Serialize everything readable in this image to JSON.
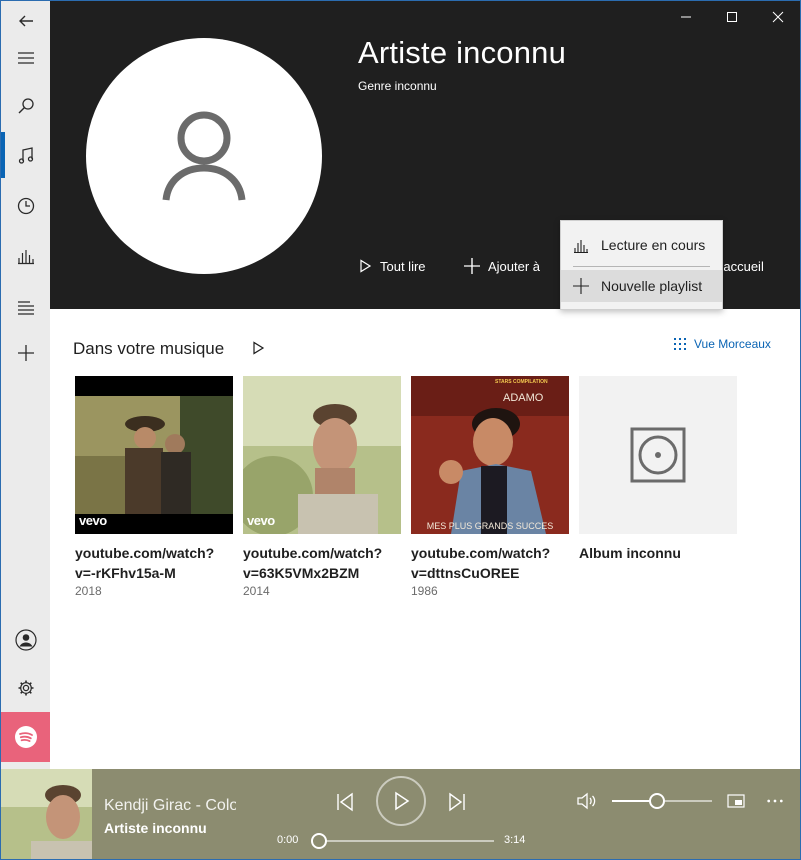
{
  "window": {
    "controls": [
      "minimize",
      "maximize",
      "close"
    ]
  },
  "sidebar": {
    "items": [
      {
        "icon": "back-arrow-icon"
      },
      {
        "icon": "hamburger-icon"
      },
      {
        "icon": "search-icon"
      },
      {
        "icon": "music-note-icon",
        "active": true
      },
      {
        "icon": "clock-icon"
      },
      {
        "icon": "equalizer-icon"
      },
      {
        "icon": "playlist-icon"
      },
      {
        "icon": "plus-icon"
      },
      {
        "icon": "account-icon"
      },
      {
        "icon": "gear-icon"
      },
      {
        "icon": "spotify-icon"
      }
    ],
    "accent": "#0a64b4",
    "spotify_color": "#e9637b"
  },
  "header": {
    "title": "Artiste inconnu",
    "genre": "Genre inconnu",
    "actions": {
      "play_all": "Tout lire",
      "add_to": "Ajouter à",
      "pin_partial": "l'accueil"
    }
  },
  "flyout": {
    "items": [
      {
        "label": "Lecture en cours",
        "icon": "now-playing-icon"
      },
      {
        "label": "Nouvelle playlist",
        "icon": "plus-icon"
      }
    ]
  },
  "content": {
    "section_title": "Dans votre musique",
    "view_link": "Vue Morceaux",
    "albums": [
      {
        "title_line1": "youtube.com/watch?",
        "title_line2": "v=-rKFhv15a-M",
        "year": "2018",
        "badge": "vevo"
      },
      {
        "title_line1": "youtube.com/watch?",
        "title_line2": "v=63K5VMx2BZM",
        "year": "2014",
        "badge": "vevo"
      },
      {
        "title_line1": "youtube.com/watch?",
        "title_line2": "v=dttnsCuOREE",
        "year": "1986",
        "cover_top": "STARS COMPILATION",
        "cover_name": "ADAMO",
        "cover_bottom": "MES PLUS GRANDS SUCCES"
      },
      {
        "title_line1": "Album inconnu",
        "title_line2": "",
        "year": ""
      }
    ]
  },
  "player": {
    "track_title": "Kendji Girac - Color Gitano",
    "track_artist": "Artiste inconnu",
    "time_current": "0:00",
    "time_total": "3:14",
    "progress": 0,
    "volume": 0.45,
    "bar_color": "#8c8c70"
  }
}
